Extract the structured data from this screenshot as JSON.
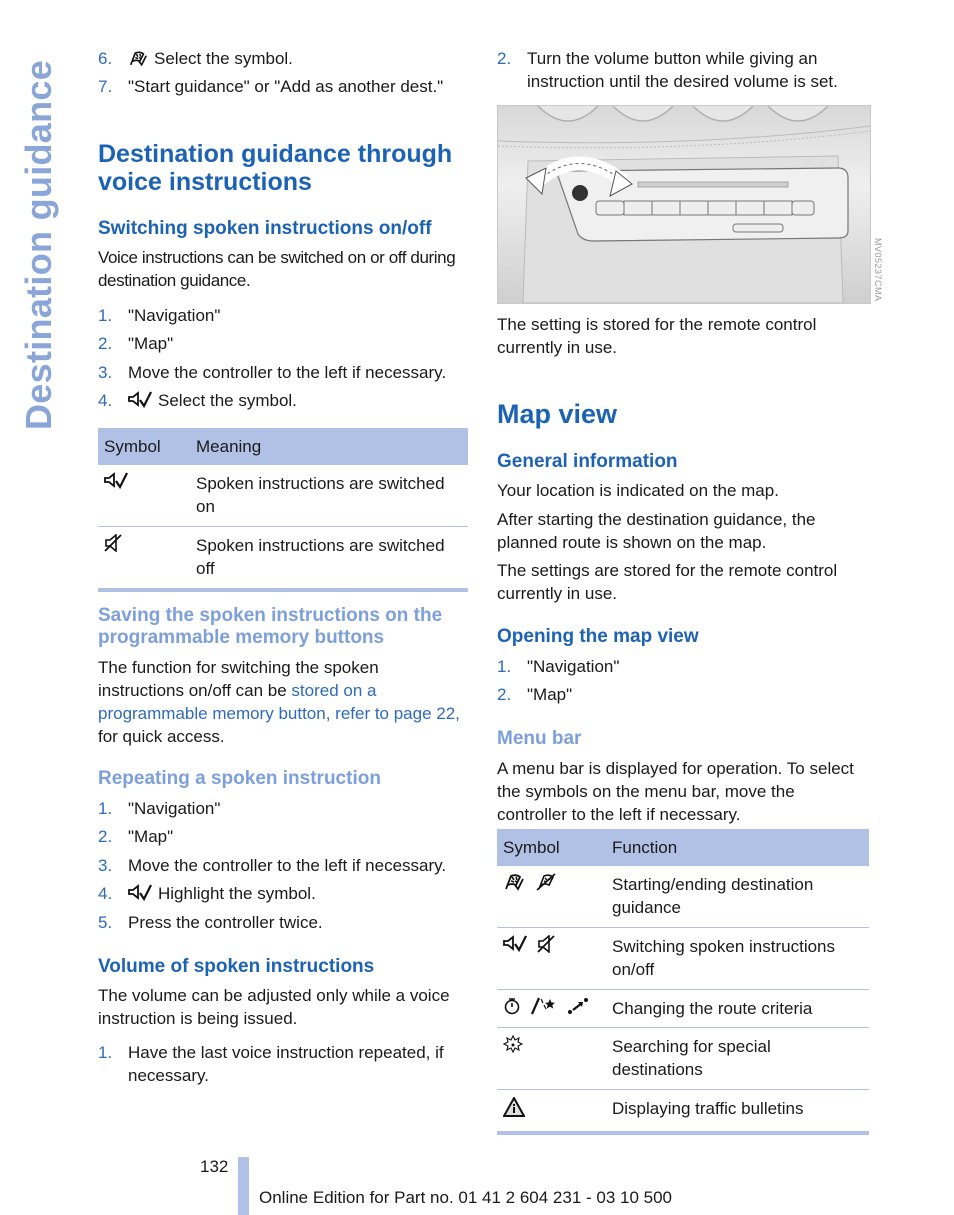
{
  "side_title": "Destination guidance",
  "left": {
    "top_list": [
      {
        "num": "6.",
        "icon": "destination-flag-icon",
        "text": "Select the symbol."
      },
      {
        "num": "7.",
        "text": "\"Start guidance\" or \"Add as another dest.\""
      }
    ],
    "section_title": "Destination guidance through voice instructions",
    "sub1": {
      "title": "Switching spoken instructions on/off",
      "intro": "Voice instructions can be switched on or off during destination guidance.",
      "steps": [
        {
          "num": "1.",
          "text": "\"Navigation\""
        },
        {
          "num": "2.",
          "text": "\"Map\""
        },
        {
          "num": "3.",
          "text": "Move the controller to the left if necessary."
        },
        {
          "num": "4.",
          "icon": "speaker-on-icon",
          "text": "Select the symbol."
        }
      ],
      "table": {
        "headers": [
          "Symbol",
          "Meaning"
        ],
        "rows": [
          {
            "icon": "speaker-on-icon",
            "meaning": "Spoken instructions are switched on"
          },
          {
            "icon": "speaker-off-icon",
            "meaning": "Spoken instructions are switched off"
          }
        ]
      }
    },
    "sub2": {
      "title": "Saving the spoken instructions on the programmable memory buttons",
      "text_before": "The function for switching the spoken instructions on/off can be ",
      "link": "stored on a programmable memory button, refer to page 22,",
      "text_after": " for quick access."
    },
    "sub3": {
      "title": "Repeating a spoken instruction",
      "steps": [
        {
          "num": "1.",
          "text": "\"Navigation\""
        },
        {
          "num": "2.",
          "text": "\"Map\""
        },
        {
          "num": "3.",
          "text": "Move the controller to the left if necessary."
        },
        {
          "num": "4.",
          "icon": "speaker-on-icon",
          "text": "Highlight the symbol."
        },
        {
          "num": "5.",
          "text": "Press the controller twice."
        }
      ]
    },
    "sub4": {
      "title": "Volume of spoken instructions",
      "intro": "The volume can be adjusted only while a voice instruction is being issued.",
      "steps": [
        {
          "num": "1.",
          "text": "Have the last voice instruction repeated, if necessary."
        }
      ]
    }
  },
  "right": {
    "step2": {
      "num": "2.",
      "text": "Turn the volume button while giving an instruction until the desired volume is set."
    },
    "photo_code": "MV05237CMA",
    "after_photo": "The setting is stored for the remote control currently in use.",
    "section_title": "Map view",
    "general": {
      "title": "General information",
      "paras": [
        "Your location is indicated on the map.",
        "After starting the destination guidance, the planned route is shown on the map.",
        "The settings are stored for the remote control currently in use."
      ]
    },
    "opening": {
      "title": "Opening the map view",
      "steps": [
        {
          "num": "1.",
          "text": "\"Navigation\""
        },
        {
          "num": "2.",
          "text": "\"Map\""
        }
      ]
    },
    "menubar": {
      "title": "Menu bar",
      "intro": "A menu bar is displayed for operation. To select the symbols on the menu bar, move the controller to the left if necessary.",
      "table": {
        "headers": [
          "Symbol",
          "Function"
        ],
        "rows": [
          {
            "icons": [
              "start-guidance-icon",
              "end-guidance-icon"
            ],
            "function": "Starting/ending destination guidance"
          },
          {
            "icons": [
              "speaker-on-icon",
              "speaker-off-icon"
            ],
            "function": "Switching spoken instructions on/off"
          },
          {
            "icons": [
              "stopwatch-icon",
              "road-star-icon",
              "route-arrow-icon"
            ],
            "function": "Changing the route criteria"
          },
          {
            "icons": [
              "special-destination-icon"
            ],
            "function": "Searching for special destinations"
          },
          {
            "icons": [
              "traffic-warning-icon"
            ],
            "function": "Displaying traffic bulletins"
          }
        ]
      }
    }
  },
  "footer": {
    "page_number": "132",
    "edition": "Online Edition for Part no. 01 41 2 604 231 - 03 10 500"
  },
  "colors": {
    "heading_blue": "#1c62b5",
    "light_heading": "#7d9fdb",
    "table_header": "#b1c1e5",
    "side_title": "#8aa6d8"
  }
}
